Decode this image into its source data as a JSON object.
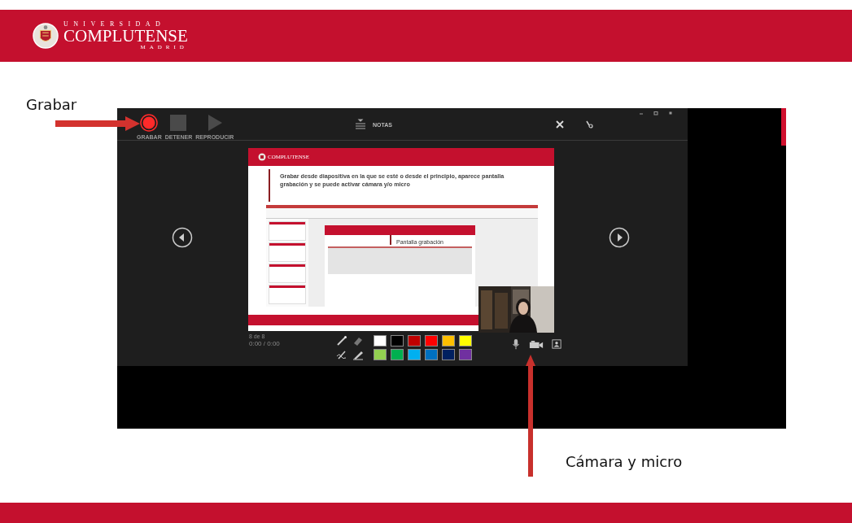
{
  "header": {
    "logo": {
      "top": "UNIVERSIDAD",
      "name": "COMPLUTENSE",
      "bottom": "MADRID"
    }
  },
  "callouts": [
    {
      "text": "Grabar"
    },
    {
      "text": "Cámara y micro"
    }
  ],
  "recorder": {
    "controls": [
      {
        "kind": "record",
        "label": "GRABAR"
      },
      {
        "kind": "stop",
        "label": "DETENER"
      },
      {
        "kind": "play",
        "label": "REPRODUCIR"
      }
    ],
    "notes": "NOTAS",
    "slide": {
      "logo": "COMPLUTENSE",
      "text": "Grabar desde diapositiva en la que se esté o desde el principio, aparece pantalla grabación y se puede activar cámara y/o micro",
      "inner_caption": "Pantalla grabación"
    },
    "counter": "8 de 8",
    "time": "0:00 / 0:00",
    "pen_colors": [
      {
        "color": "#ffffff"
      },
      {
        "color": "#000000"
      },
      {
        "color": "#c00000"
      },
      {
        "color": "#ff0000"
      },
      {
        "color": "#ffc000"
      },
      {
        "color": "#ffff00"
      },
      {
        "color": "#92d050"
      },
      {
        "color": "#00b050"
      },
      {
        "color": "#00b0f0"
      },
      {
        "color": "#0070c0"
      },
      {
        "color": "#002060"
      },
      {
        "color": "#7030a0"
      }
    ]
  }
}
